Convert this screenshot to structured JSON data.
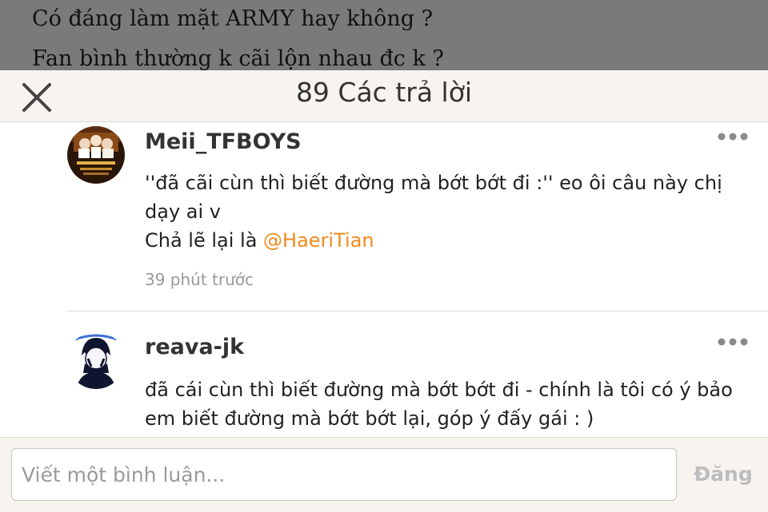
{
  "story": {
    "lines": [
      "Có đáng làm mặt ARMY hay không ?",
      "Fan bình thường k cãi lộn nhau đc k ?"
    ]
  },
  "header": {
    "title": "89 Các trả lời",
    "close_icon": "close-icon"
  },
  "comments": [
    {
      "username": "Meii_TFBOYS",
      "text_line": "''đã cãi cùn thì biết đường mà bớt bớt đi :'' eo ôi câu này chị dạy ai v",
      "text_prefix": "Chả lẽ lại là ",
      "mention": "@HaeriTian",
      "time": "39 phút trước",
      "more_icon": "more-dots-icon"
    },
    {
      "username": "reava-jk",
      "text_line": "đã cái cùn thì biết đường mà bớt bớt đi - chính là tôi có ý bảo em biết đường mà bớt bớt lại, góp ý đấy gái : )",
      "more_icon": "more-dots-icon"
    }
  ],
  "composer": {
    "placeholder": "Viết một bình luận...",
    "value": "",
    "post_label": "Đăng"
  },
  "colors": {
    "accent": "#f28a1e",
    "header_bg": "#f7f4ef",
    "backdrop": "#7a7a7a"
  }
}
